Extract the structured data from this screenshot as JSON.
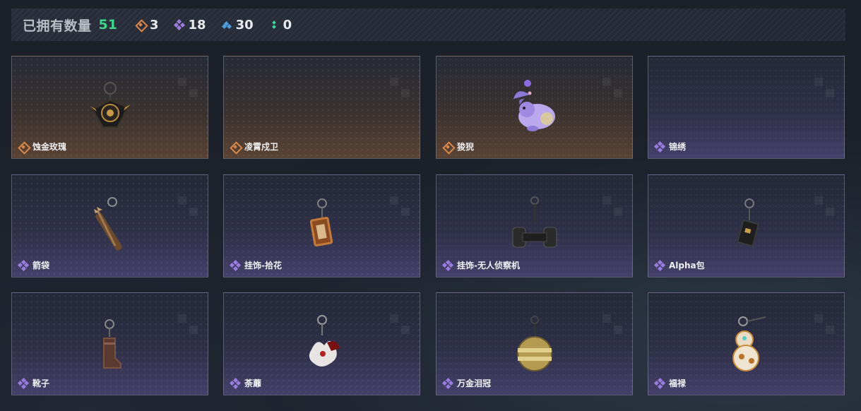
{
  "summary": {
    "label": "已拥有数量",
    "total": "51",
    "counts": [
      {
        "rarity": "orange",
        "icon": "orange-diamond-icon",
        "value": "3",
        "color": "#d9874a"
      },
      {
        "rarity": "purple",
        "icon": "purple-diamond-icon",
        "value": "18",
        "color": "#9a7be0"
      },
      {
        "rarity": "blue",
        "icon": "blue-diamond-icon",
        "value": "30",
        "color": "#4b9fdd"
      },
      {
        "rarity": "green",
        "icon": "green-diamond-icon",
        "value": "0",
        "color": "#3fd6a0"
      }
    ]
  },
  "items": [
    {
      "name": "蚀金玫瑰",
      "rarity": "orange",
      "art": "rose-charm"
    },
    {
      "name": "凌霄戍卫",
      "rarity": "orange",
      "art": "none"
    },
    {
      "name": "狻猊",
      "rarity": "orange",
      "art": "lion-charm"
    },
    {
      "name": "锦绣",
      "rarity": "purple",
      "art": "none"
    },
    {
      "name": "箭袋",
      "rarity": "purple",
      "art": "quiver-charm"
    },
    {
      "name": "挂饰-拾花",
      "rarity": "purple",
      "art": "frame-charm"
    },
    {
      "name": "挂饰-无人侦察机",
      "rarity": "purple",
      "art": "drone-charm"
    },
    {
      "name": "Alpha包",
      "rarity": "purple",
      "art": "bag-charm"
    },
    {
      "name": "靴子",
      "rarity": "purple",
      "art": "boot-charm"
    },
    {
      "name": "荼蘼",
      "rarity": "purple",
      "art": "flower-charm"
    },
    {
      "name": "万金泪冠",
      "rarity": "purple",
      "art": "crown-charm"
    },
    {
      "name": "福禄",
      "rarity": "purple",
      "art": "gourd-charm"
    }
  ]
}
